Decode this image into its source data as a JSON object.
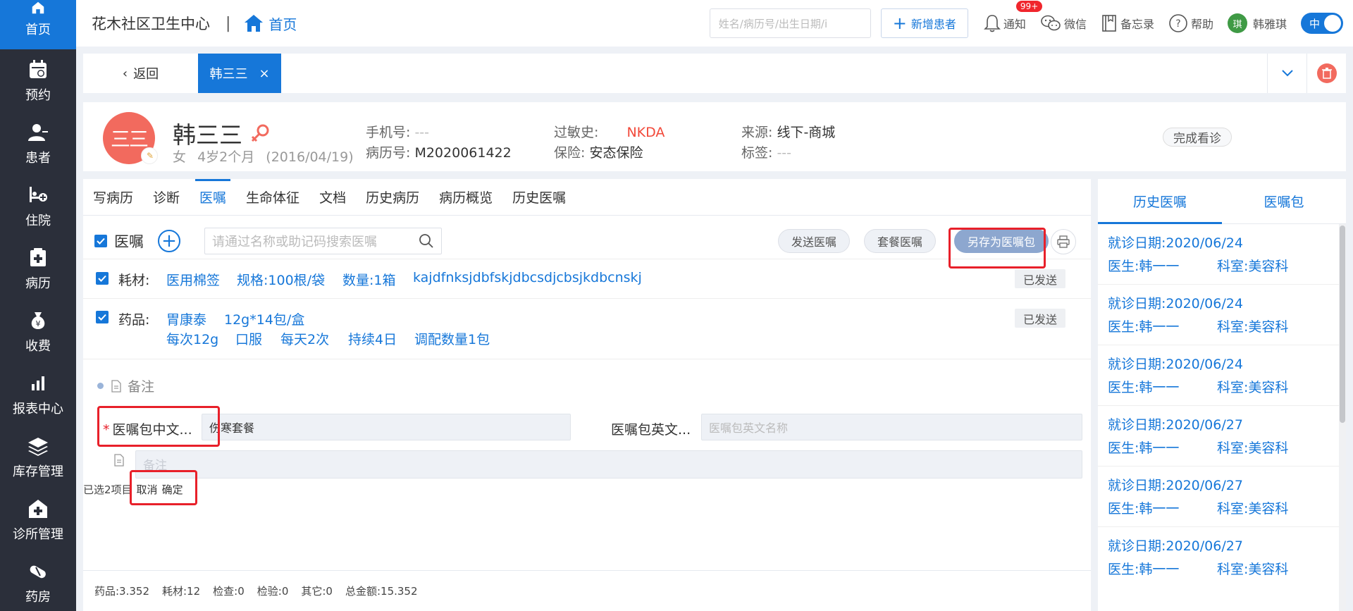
{
  "sidebar": {
    "items": [
      {
        "label": "首页",
        "icon": "home-icon"
      },
      {
        "label": "预约",
        "icon": "calendar-icon"
      },
      {
        "label": "患者",
        "icon": "user-icon"
      },
      {
        "label": "住院",
        "icon": "bed-icon"
      },
      {
        "label": "病历",
        "icon": "medical-record-icon"
      },
      {
        "label": "收费",
        "icon": "money-bag-icon"
      },
      {
        "label": "报表中心",
        "icon": "bar-chart-icon"
      },
      {
        "label": "库存管理",
        "icon": "layers-icon"
      },
      {
        "label": "诊所管理",
        "icon": "clinic-icon"
      },
      {
        "label": "药房",
        "icon": "pill-icon"
      }
    ]
  },
  "topbar": {
    "clinic_name": "花木社区卫生中心",
    "separator": "|",
    "breadcrumb_home": "首页",
    "search_placeholder": "姓名/病历号/出生日期/i",
    "new_patient": "新增患者",
    "notify": "通知",
    "notify_badge": "99+",
    "wechat": "微信",
    "memo": "备忘录",
    "help": "帮助",
    "user_name": "韩雅琪",
    "user_initial": "琪",
    "lang_toggle": "中"
  },
  "patient_tabs": {
    "back": "返回",
    "active_tab": "韩三三"
  },
  "patient": {
    "avatar_text": "三三",
    "name": "韩三三",
    "gender": "女",
    "age": "4岁2个月",
    "birthday": "(2016/04/19)",
    "phone_label": "手机号:",
    "phone_value": "---",
    "record_label": "病历号:",
    "record_value": "M2020061422",
    "allergy_label": "过敏史:",
    "allergy_value": "NKDA",
    "insurance_label": "保险:",
    "insurance_value": "安态保险",
    "source_label": "来源:",
    "source_value": "线下-商城",
    "tag_label": "标签:",
    "tag_value": "---",
    "finish_button": "完成看诊"
  },
  "main_tabs": [
    "写病历",
    "诊断",
    "医嘱",
    "生命体征",
    "文档",
    "历史病历",
    "病历概览",
    "历史医嘱"
  ],
  "orders": {
    "title": "医嘱",
    "search_placeholder": "请通过名称或助记码搜索医嘱",
    "send_button": "发送医嘱",
    "package_button": "套餐医嘱",
    "save_as_button": "另存为医嘱包",
    "rows": [
      {
        "category": "耗材:",
        "name": "医用棉签",
        "spec": "规格:100根/袋",
        "qty": "数量:1箱",
        "code": "kajdfnksjdbfskjdbcsdjcbsjkdbcnskj",
        "status": "已发送"
      },
      {
        "category": "药品:",
        "name": "胃康泰",
        "spec": "12g*14包/盒",
        "dose": "每次12g",
        "route": "口服",
        "freq": "每天2次",
        "duration": "持续4日",
        "dispense": "调配数量1包",
        "status": "已发送"
      }
    ],
    "remark_label": "备注"
  },
  "package_form": {
    "cn_label": "医嘱包中文...",
    "cn_value": "伤寒套餐",
    "en_label": "医嘱包英文...",
    "en_placeholder": "医嘱包英文名称",
    "remark_placeholder": "备注",
    "selected_info": "已选2项目",
    "cancel": "取消",
    "confirm": "确定"
  },
  "footer": {
    "drug": "药品:3.352",
    "material": "耗材:12",
    "exam": "检查:0",
    "test": "检验:0",
    "other": "其它:0",
    "total": "总金额:15.352"
  },
  "right_panel": {
    "tabs": [
      "历史医嘱",
      "医嘱包"
    ],
    "history": [
      {
        "date": "就诊日期:2020/06/24",
        "doctor": "医生:韩一一",
        "dept": "科室:美容科"
      },
      {
        "date": "就诊日期:2020/06/24",
        "doctor": "医生:韩一一",
        "dept": "科室:美容科"
      },
      {
        "date": "就诊日期:2020/06/24",
        "doctor": "医生:韩一一",
        "dept": "科室:美容科"
      },
      {
        "date": "就诊日期:2020/06/27",
        "doctor": "医生:韩一一",
        "dept": "科室:美容科"
      },
      {
        "date": "就诊日期:2020/06/27",
        "doctor": "医生:韩一一",
        "dept": "科室:美容科"
      },
      {
        "date": "就诊日期:2020/06/27",
        "doctor": "医生:韩一一",
        "dept": "科室:美容科"
      }
    ]
  },
  "colors": {
    "primary": "#1677d9",
    "sidebar": "#2b2f3a",
    "avatar": "#f26a5e",
    "highlight_box": "#e8202a",
    "allergy": "#f2493a"
  }
}
